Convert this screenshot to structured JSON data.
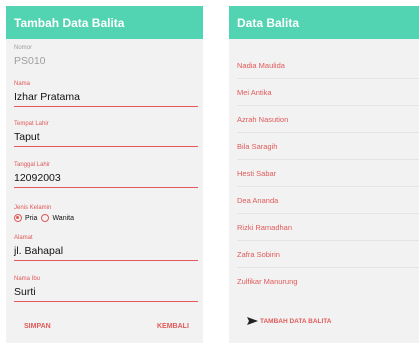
{
  "form": {
    "title": "Tambah Data Balita",
    "nomor": {
      "label": "Nomor",
      "value": "PS010"
    },
    "nama": {
      "label": "Nama",
      "value": "Izhar Pratama"
    },
    "tempat_lahir": {
      "label": "Tempat Lahir",
      "value": "Taput"
    },
    "tanggal_lahir": {
      "label": "Tanggal Lahir",
      "value": "12092003"
    },
    "jenis_kelamin": {
      "label": "Jenis Kelamin",
      "options": [
        "Pria",
        "Wanita"
      ],
      "selected": "Pria"
    },
    "alamat": {
      "label": "Alamat",
      "value": "jl. Bahapal"
    },
    "nama_ibu": {
      "label": "Nama Ibu",
      "value": "Surti"
    },
    "save_label": "SIMPAN",
    "back_label": "KEMBALI"
  },
  "list_screen": {
    "title": "Data Balita",
    "items": [
      "Nadia Maulida",
      "Mei Antika",
      "Azrah Nasution",
      "Bila Saragih",
      "Hesti Sabar",
      "Dea Ananda",
      "Rizki Ramadhan",
      "Zafra Sobirin",
      "Zulfikar Manurung"
    ],
    "add_label": "TAMBAH DATA BALITA"
  },
  "colors": {
    "appbar": "#52d3b1",
    "accent": "#e05a5a",
    "panel_bg": "#f2f2f2"
  }
}
